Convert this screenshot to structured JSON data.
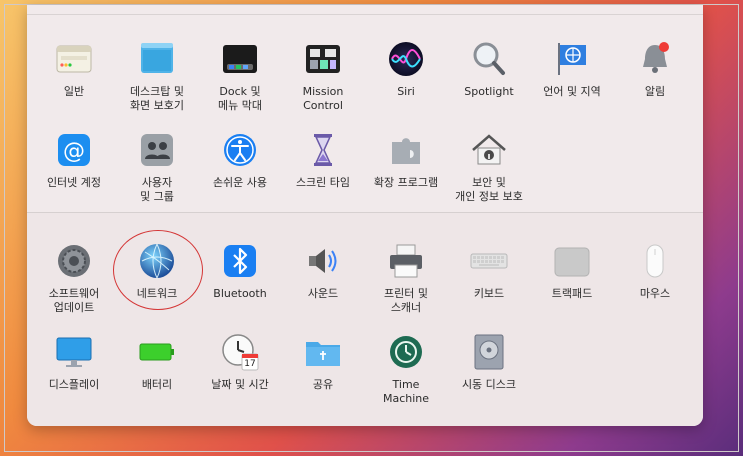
{
  "rows": [
    [
      {
        "name": "general",
        "label": "일반",
        "icon": "general-icon"
      },
      {
        "name": "desktop-screensaver",
        "label": "데스크탑 및\n화면 보호기",
        "icon": "desktop-icon"
      },
      {
        "name": "dock-menubar",
        "label": "Dock 및\n메뉴 막대",
        "icon": "dock-icon"
      },
      {
        "name": "mission-control",
        "label": "Mission\nControl",
        "icon": "mission-control-icon"
      },
      {
        "name": "siri",
        "label": "Siri",
        "icon": "siri-icon"
      },
      {
        "name": "spotlight",
        "label": "Spotlight",
        "icon": "spotlight-icon"
      },
      {
        "name": "language-region",
        "label": "언어 및 지역",
        "icon": "flag-globe-icon"
      },
      {
        "name": "notifications",
        "label": "알림",
        "icon": "bell-icon"
      }
    ],
    [
      {
        "name": "internet-accounts",
        "label": "인터넷 계정",
        "icon": "at-icon"
      },
      {
        "name": "users-groups",
        "label": "사용자\n및 그룹",
        "icon": "users-icon"
      },
      {
        "name": "accessibility",
        "label": "손쉬운 사용",
        "icon": "accessibility-icon"
      },
      {
        "name": "screen-time",
        "label": "스크린 타임",
        "icon": "hourglass-icon"
      },
      {
        "name": "extensions",
        "label": "확장 프로그램",
        "icon": "puzzle-icon"
      },
      {
        "name": "security-privacy",
        "label": "보안 및\n개인 정보 보호",
        "icon": "house-lock-icon"
      }
    ],
    [
      {
        "name": "software-update",
        "label": "소프트웨어\n업데이트",
        "icon": "gear-icon"
      },
      {
        "name": "network",
        "label": "네트워크",
        "icon": "network-globe-icon"
      },
      {
        "name": "bluetooth",
        "label": "Bluetooth",
        "icon": "bluetooth-icon"
      },
      {
        "name": "sound",
        "label": "사운드",
        "icon": "speaker-icon"
      },
      {
        "name": "printers-scanners",
        "label": "프린터 및\n스캐너",
        "icon": "printer-icon"
      },
      {
        "name": "keyboard",
        "label": "키보드",
        "icon": "keyboard-icon"
      },
      {
        "name": "trackpad",
        "label": "트랙패드",
        "icon": "trackpad-icon"
      },
      {
        "name": "mouse",
        "label": "마우스",
        "icon": "mouse-icon"
      }
    ],
    [
      {
        "name": "displays",
        "label": "디스플레이",
        "icon": "display-icon"
      },
      {
        "name": "battery",
        "label": "배터리",
        "icon": "battery-icon"
      },
      {
        "name": "date-time",
        "label": "날짜 및 시간",
        "icon": "clock-icon",
        "calendar_day": "17"
      },
      {
        "name": "sharing",
        "label": "공유",
        "icon": "folder-icon"
      },
      {
        "name": "time-machine",
        "label": "Time\nMachine",
        "icon": "time-machine-icon"
      },
      {
        "name": "startup-disk",
        "label": "시동 디스크",
        "icon": "disk-icon"
      }
    ]
  ],
  "colors": {
    "highlight": "#d43535",
    "accent": "#1a7ff2"
  }
}
